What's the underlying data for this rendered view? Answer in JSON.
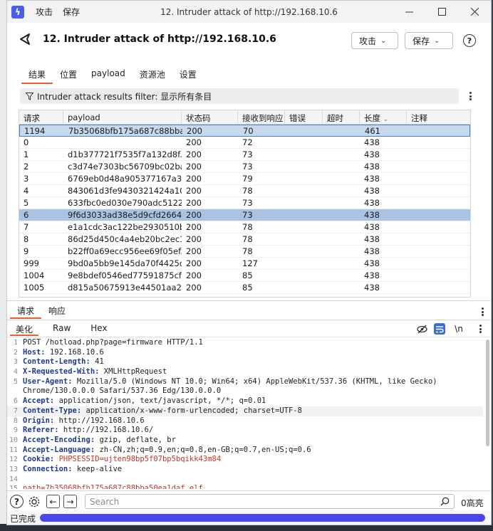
{
  "titlebar": {
    "menus": [
      "攻击",
      "保存"
    ],
    "title": "12. Intruder attack of http://192.168.10.6"
  },
  "header": {
    "title": "12. Intruder attack of http://192.168.10.6",
    "attack_button": "攻击",
    "save_button": "保存"
  },
  "tabs": [
    "结果",
    "位置",
    "payload",
    "资源池",
    "设置"
  ],
  "filter": {
    "text": "Intruder attack results filter: 显示所有条目"
  },
  "table": {
    "columns": [
      "请求",
      "payload",
      "状态码",
      "接收到响应",
      "错误",
      "超时",
      "长度",
      "注释"
    ],
    "rows": [
      [
        "1194",
        "7b35068bfb175a687c88bba...",
        "200",
        "70",
        "",
        "",
        "461",
        ""
      ],
      [
        "0",
        "",
        "200",
        "72",
        "",
        "",
        "438",
        ""
      ],
      [
        "1",
        "d1b377721f7535f7a132d8f...",
        "200",
        "73",
        "",
        "",
        "438",
        ""
      ],
      [
        "2",
        "c3d74e7303bc56709bc02ba...",
        "200",
        "73",
        "",
        "",
        "438",
        ""
      ],
      [
        "3",
        "6769eb0d48a905377167a3...",
        "200",
        "79",
        "",
        "",
        "438",
        ""
      ],
      [
        "4",
        "843061d3fe9430321424a10...",
        "200",
        "78",
        "",
        "",
        "438",
        ""
      ],
      [
        "5",
        "633fbc0ed030e790adc5122...",
        "200",
        "73",
        "",
        "",
        "438",
        ""
      ],
      [
        "6",
        "9f6d3033ad38e5d9cfd2664...",
        "200",
        "73",
        "",
        "",
        "438",
        ""
      ],
      [
        "7",
        "e1a1cdc3ac122be2930510b...",
        "200",
        "78",
        "",
        "",
        "438",
        ""
      ],
      [
        "8",
        "86d25d450c4a4eb20bc2ec1...",
        "200",
        "78",
        "",
        "",
        "438",
        ""
      ],
      [
        "9",
        "b22ff0a69ecc956ee69f05ef...",
        "200",
        "78",
        "",
        "",
        "438",
        ""
      ],
      [
        "999",
        "9bd0a5bb9e145da70f4425d...",
        "200",
        "127",
        "",
        "",
        "438",
        ""
      ],
      [
        "1004",
        "9e8bdef0546ed77591875cf...",
        "200",
        "85",
        "",
        "",
        "438",
        ""
      ],
      [
        "1005",
        "d815a50675913e44501aa27...",
        "200",
        "85",
        "",
        "",
        "438",
        ""
      ]
    ]
  },
  "lower_tabs": [
    "请求",
    "响应"
  ],
  "sub_tabs": [
    "美化",
    "Raw",
    "Hex"
  ],
  "newline_toggle": "\\n",
  "editor": {
    "lines": [
      {
        "n": "1",
        "k": "",
        "v": "POST /hotload.php?page=firmware HTTP/1.1"
      },
      {
        "n": "2",
        "k": "Host:",
        "v": " 192.168.10.6"
      },
      {
        "n": "3",
        "k": "Content-Length:",
        "v": " 41"
      },
      {
        "n": "4",
        "k": "X-Requested-With:",
        "v": " XMLHttpRequest"
      },
      {
        "n": "5",
        "k": "User-Agent:",
        "v": " Mozilla/5.0 (Windows NT 10.0; Win64; x64) AppleWebKit/537.36 (KHTML, like Gecko)"
      },
      {
        "n": "",
        "k": "",
        "v": "Chrome/130.0.0.0 Safari/537.36 Edg/130.0.0.0"
      },
      {
        "n": "6",
        "k": "Accept:",
        "v": " application/json, text/javascript, */*; q=0.01"
      },
      {
        "n": "7",
        "k": "Content-Type:",
        "v": " application/x-www-form-urlencoded; charset=UTF-8"
      },
      {
        "n": "8",
        "k": "Origin:",
        "v": " http://192.168.10.6"
      },
      {
        "n": "9",
        "k": "Referer:",
        "v": " http://192.168.10.6/"
      },
      {
        "n": "10",
        "k": "Accept-Encoding:",
        "v": " gzip, deflate, br"
      },
      {
        "n": "11",
        "k": "Accept-Language:",
        "v": " zh-CN,zh;q=0.9,en;q=0.8,en-GB;q=0.7,en-US;q=0.6"
      },
      {
        "n": "12",
        "k": "Cookie:",
        "v": " PHPSESSID=ujten98bp5f07bp5bqikk43m84"
      },
      {
        "n": "13",
        "k": "Connection:",
        "v": " keep-alive"
      },
      {
        "n": "14",
        "k": "",
        "v": ""
      },
      {
        "n": "15",
        "k": "",
        "v": "path=7b35068bfb175a687c88bba50ea1daf.elf"
      }
    ]
  },
  "search": {
    "placeholder": "Search",
    "highlights": "0高亮"
  },
  "status": {
    "text": "已完成",
    "progress": 1.0
  },
  "colors": {
    "accent": "#e8612c",
    "selection": "#c7d9ee",
    "progress": "#4b47e6"
  }
}
